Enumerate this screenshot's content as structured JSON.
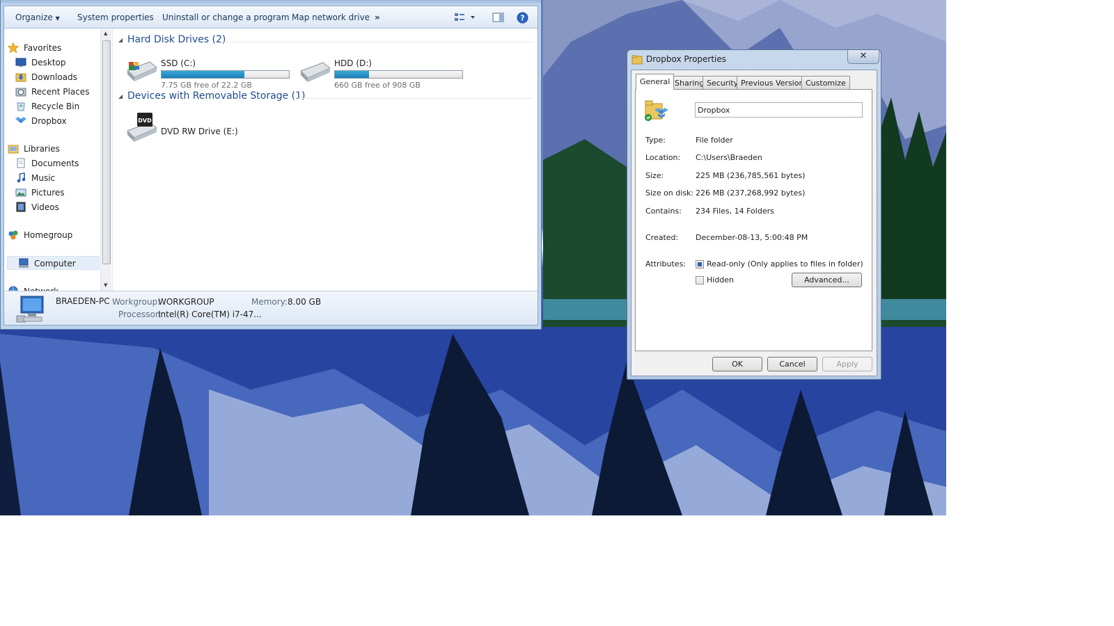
{
  "explorer": {
    "toolbar": {
      "organize": "Organize",
      "system_properties": "System properties",
      "uninstall": "Uninstall or change a program",
      "map_drive": "Map network drive",
      "more": "»"
    },
    "nav": {
      "favorites": "Favorites",
      "desktop": "Desktop",
      "downloads": "Downloads",
      "recent_places": "Recent Places",
      "recycle_bin": "Recycle Bin",
      "dropbox": "Dropbox",
      "libraries": "Libraries",
      "documents": "Documents",
      "music": "Music",
      "pictures": "Pictures",
      "videos": "Videos",
      "homegroup": "Homegroup",
      "computer": "Computer",
      "network": "Network"
    },
    "content": {
      "hdd_group": "Hard Disk Drives (2)",
      "removable_group": "Devices with Removable Storage (1)",
      "drives": [
        {
          "name": "SSD (C:)",
          "free": "7.75 GB free of 22.2 GB",
          "used_fraction": 0.65
        },
        {
          "name": "HDD (D:)",
          "free": "660 GB free of 908 GB",
          "used_fraction": 0.27
        }
      ],
      "dvd": {
        "name": "DVD RW Drive (E:)",
        "badge": "DVD"
      }
    },
    "details": {
      "pc_name": "BRAEDEN-PC",
      "workgroup_label": "Workgroup:",
      "workgroup": "WORKGROUP",
      "memory_label": "Memory:",
      "memory": "8.00 GB",
      "processor_label": "Processor:",
      "processor": "Intel(R) Core(TM) i7-47..."
    }
  },
  "props": {
    "title": "Dropbox Properties",
    "close": "✕",
    "tabs": [
      "General",
      "Sharing",
      "Security",
      "Previous Versions",
      "Customize"
    ],
    "name": "Dropbox",
    "fields": {
      "type_label": "Type:",
      "type": "File folder",
      "location_label": "Location:",
      "location": "C:\\Users\\Braeden",
      "size_label": "Size:",
      "size": "225 MB (236,785,561 bytes)",
      "size_disk_label": "Size on disk:",
      "size_disk": "226 MB (237,268,992 bytes)",
      "contains_label": "Contains:",
      "contains": "234 Files, 14 Folders",
      "created_label": "Created:",
      "created": "December-08-13, 5:00:48 PM",
      "attributes_label": "Attributes:"
    },
    "attributes": {
      "readonly": "Read-only (Only applies to files in folder)",
      "hidden": "Hidden",
      "advanced": "Advanced..."
    },
    "buttons": {
      "ok": "OK",
      "cancel": "Cancel",
      "apply": "Apply"
    }
  }
}
